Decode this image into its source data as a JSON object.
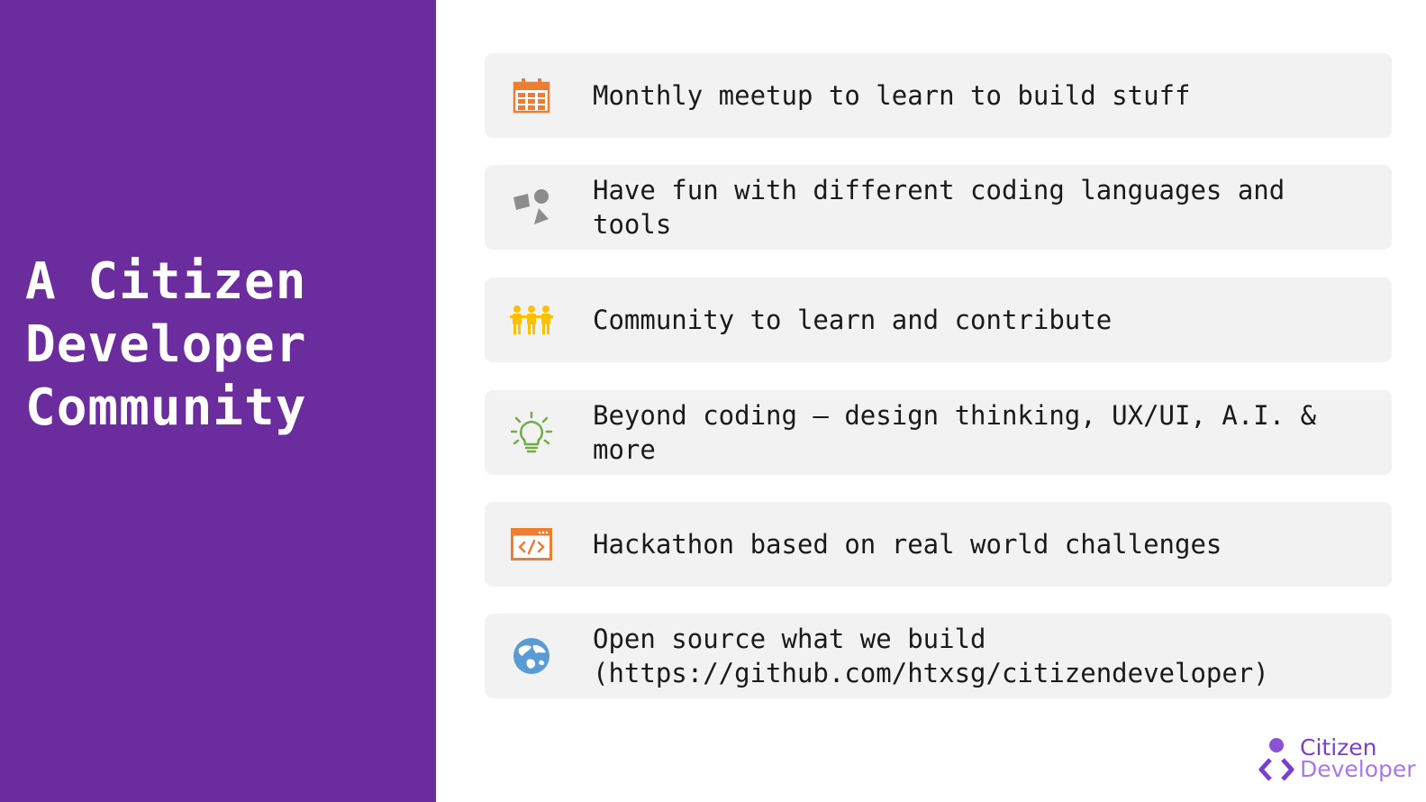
{
  "sidebar": {
    "title": "A Citizen\nDeveloper\nCommunity"
  },
  "features": [
    {
      "icon": "calendar-icon",
      "text": "Monthly meetup to learn to build stuff"
    },
    {
      "icon": "shapes-icon",
      "text": "Have fun with different coding languages and tools"
    },
    {
      "icon": "people-icon",
      "text": "Community to learn and contribute"
    },
    {
      "icon": "lightbulb-icon",
      "text": "Beyond coding – design thinking, UX/UI, A.I. & more"
    },
    {
      "icon": "code-window-icon",
      "text": "Hackathon based on real world challenges"
    },
    {
      "icon": "globe-icon",
      "text": "Open source what we build (https://github.com/htxsg/citizendeveloper)"
    }
  ],
  "logo": {
    "line1": "Citizen",
    "line2": "Developer"
  },
  "colors": {
    "sidebar": "#6b2d9e",
    "card": "#f2f2f2",
    "calendar": "#ed7d31",
    "shapes": "#8c8c8c",
    "people": "#ffc000",
    "lightbulb": "#70ad47",
    "code": "#ed7d31",
    "globe": "#5b9bd5",
    "logo": "#7b3fd0"
  }
}
